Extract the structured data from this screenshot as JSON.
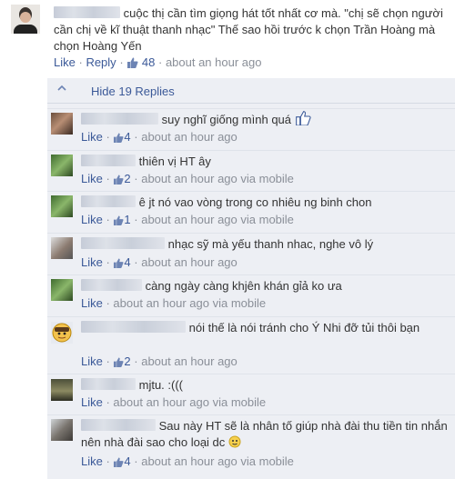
{
  "main_comment": {
    "text": "cuộc thị cần tìm giọng hát tốt nhất cơ mà. \"chị sẽ chọn người cần chị về kĩ thuật thanh nhạc\" Thế sao hồi trước k chọn Trần Hoàng mà chọn Hoàng Yến",
    "like_label": "Like",
    "reply_label": "Reply",
    "like_count": "48",
    "time": "about an hour ago"
  },
  "replies_toggle": {
    "label": "Hide 19 Replies"
  },
  "replies": [
    {
      "text": "suy nghĩ giống mình quá",
      "like_label": "Like",
      "like_count": "4",
      "time": "about an hour ago",
      "via": ""
    },
    {
      "text": "thiên vị HT ây",
      "like_label": "Like",
      "like_count": "2",
      "time": "about an hour ago",
      "via": "via mobile"
    },
    {
      "text": "ê jt nó vao vòng trong co nhiêu ng binh chon",
      "like_label": "Like",
      "like_count": "1",
      "time": "about an hour ago",
      "via": "via mobile"
    },
    {
      "text": "nhạc sỹ mà yếu thanh nhac, nghe vô lý",
      "like_label": "Like",
      "like_count": "4",
      "time": "about an hour ago",
      "via": ""
    },
    {
      "text": "càng ngày càng khjên khán gỉả ko ưa",
      "like_label": "Like",
      "like_count": "",
      "time": "about an hour ago",
      "via": "via mobile"
    },
    {
      "text": "nói thế là nói tránh cho Ý Nhi đỡ tủi thôi bạn",
      "like_label": "Like",
      "like_count": "2",
      "time": "about an hour ago",
      "via": ""
    },
    {
      "text": "mjtu. :(((",
      "like_label": "Like",
      "like_count": "",
      "time": "about an hour ago",
      "via": "via mobile"
    },
    {
      "text": "Sau này HT sẽ là nhân tố giúp nhà đài thu tiền tin nhắn nên nhà đài sao cho loại dc",
      "like_label": "Like",
      "like_count": "4",
      "time": "about an hour ago",
      "via": "via mobile"
    }
  ],
  "colors": {
    "link": "#3b5998",
    "meta": "#8a8f98",
    "panel_bg": "#edeff4"
  },
  "icons": {
    "like": "thumbs-up-icon",
    "toggle": "chevron-up-icon",
    "emoticon": "smiley-emoticon-icon"
  }
}
